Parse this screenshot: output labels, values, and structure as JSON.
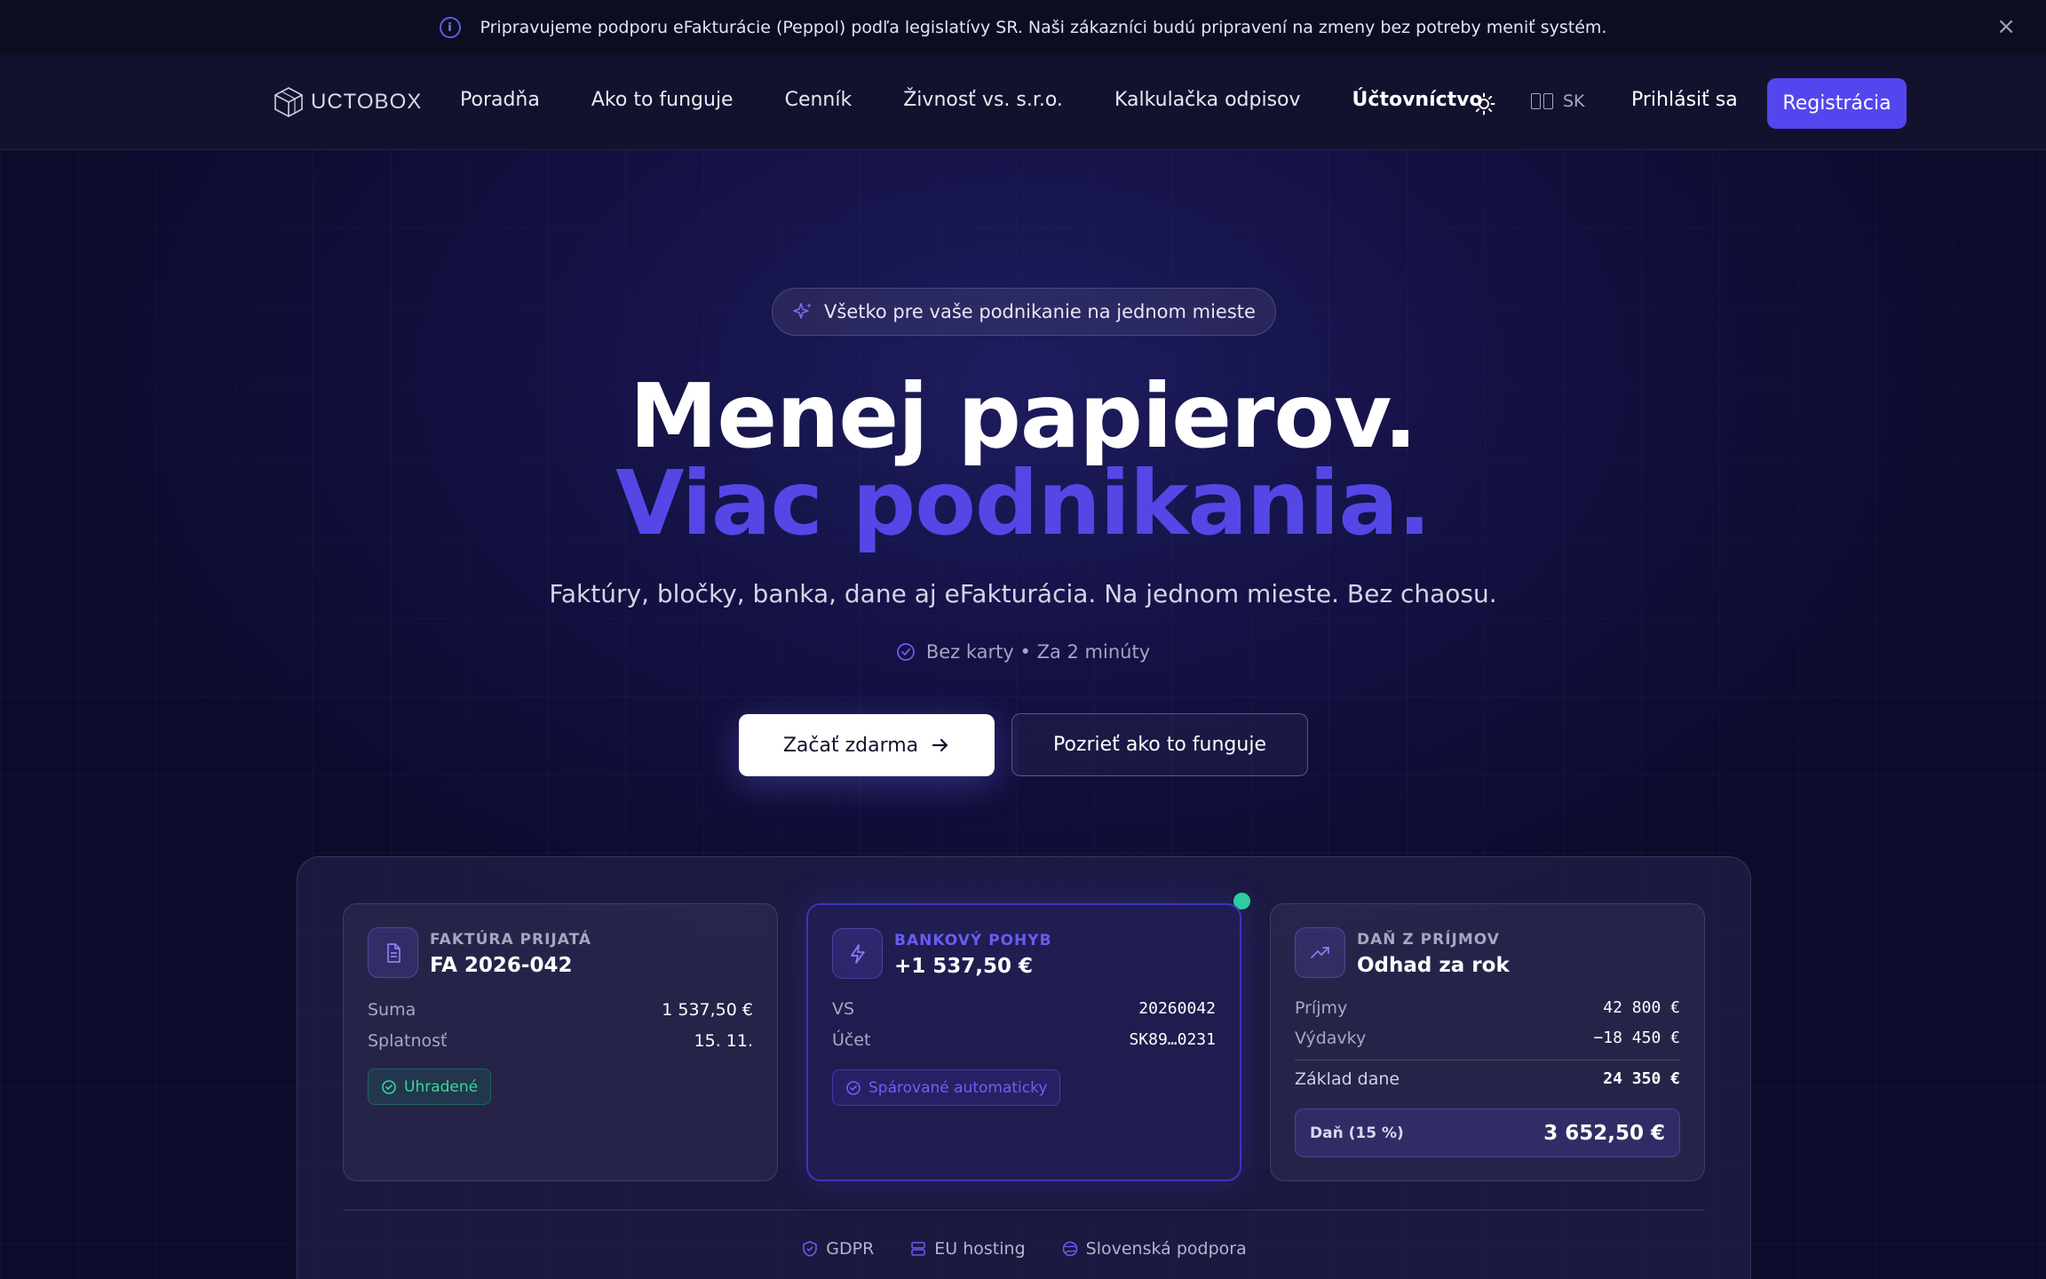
{
  "banner": {
    "text": "Pripravujeme podporu eFakturácie (Peppol) podľa legislatívy SR. Naši zákazníci budú pripravení na zmeny bez potreby meniť systém.",
    "info_icon": "info-icon",
    "close_icon": "close-icon"
  },
  "nav": {
    "logo": "UCTOBOX",
    "links": [
      "Poradňa",
      "Ako to funguje",
      "Cenník",
      "Živnosť vs. s.r.o.",
      "Kalkulačka odpisov",
      "Účtovníctvo"
    ],
    "theme_icon": "sun-icon",
    "language": "SK",
    "login": "Prihlásiť sa",
    "register": "Registrácia"
  },
  "hero": {
    "pill": "Všetko pre vaše podnikanie na jednom mieste",
    "title_line1": "Menej papierov.",
    "title_line2": "Viac podnikania.",
    "subtitle": "Faktúry, bločky, banka, dane aj eFakturácia. Na jednom mieste. Bez chaosu.",
    "note": "Bez karty • Za 2 minúty",
    "cta_primary": "Začať zdarma",
    "cta_secondary": "Pozrieť ako to funguje"
  },
  "cards": {
    "invoice": {
      "caption": "FAKTÚRA PRIJATÁ",
      "title": "FA 2026-042",
      "rows": [
        {
          "label": "Suma",
          "value": "1 537,50 €"
        },
        {
          "label": "Splatnosť",
          "value": "15. 11."
        }
      ],
      "badge": "Uhradené"
    },
    "bank": {
      "caption": "BANKOVÝ POHYB",
      "title": "+1 537,50 €",
      "rows": [
        {
          "label": "VS",
          "value": "20260042"
        },
        {
          "label": "Účet",
          "value": "SK89…0231"
        }
      ],
      "badge": "Spárované automaticky"
    },
    "tax": {
      "caption": "DAŇ Z PRÍJMOV",
      "title": "Odhad za rok",
      "rows": [
        {
          "label": "Príjmy",
          "value": "42 800 €"
        },
        {
          "label": "Výdavky",
          "value": "−18 450 €"
        },
        {
          "label": "Základ dane",
          "value": "24 350 €"
        }
      ],
      "total_label": "Daň (15 %)",
      "total_value": "3 652,50 €"
    }
  },
  "trust": [
    "GDPR",
    "EU hosting",
    "Slovenská podpora"
  ],
  "colors": {
    "accent": "#5346ee",
    "success": "#2ed39c",
    "background": "#141245"
  }
}
